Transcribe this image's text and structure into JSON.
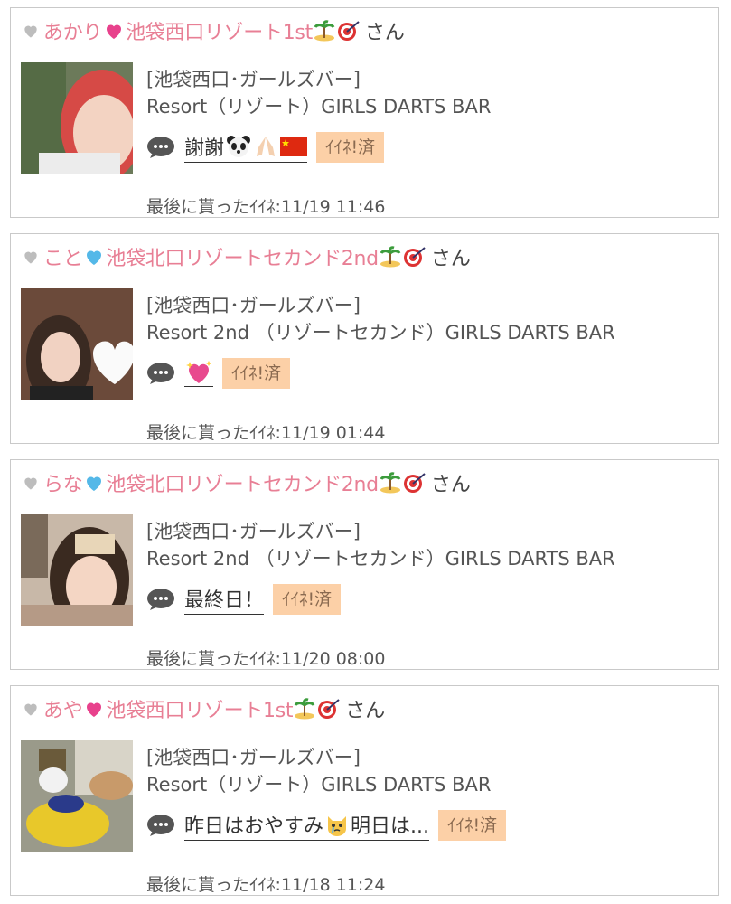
{
  "honorific": "さん",
  "badge_label": "ｲｲﾈ!済",
  "last_like_prefix": "最後に貰ったｲｲﾈ:",
  "colors": {
    "name": "#e87f95",
    "badge_bg": "#fcd0a7",
    "border": "#c9c9c9",
    "heart_gray": "#bdbdbd",
    "heart_pink": "#e8418c",
    "heart_blue": "#54b8e8"
  },
  "cards": [
    {
      "name_before": "あかり",
      "name_heart": "pink-heart-icon",
      "name_after": "池袋西口リゾート1st",
      "category": "[池袋西口･ガールズバー]",
      "shop": "Resort（リゾート）GIRLS DARTS BAR",
      "message": "謝謝",
      "message_icons": [
        "panda-icon",
        "folded-hands-icon",
        "china-flag-icon"
      ],
      "badge": "ｲｲﾈ!済",
      "last_like": "11/19 11:46"
    },
    {
      "name_before": "こと",
      "name_heart": "blue-heart-icon",
      "name_after": "池袋北口リゾートセカンド2nd",
      "category": "[池袋西口･ガールズバー]",
      "shop": "Resort 2nd （リゾートセカンド）GIRLS DARTS BAR",
      "message": "",
      "message_icons": [
        "sparkling-heart-icon"
      ],
      "badge": "ｲｲﾈ!済",
      "last_like": "11/19 01:44"
    },
    {
      "name_before": "らな",
      "name_heart": "blue-heart-icon",
      "name_after": "池袋北口リゾートセカンド2nd",
      "category": "[池袋西口･ガールズバー]",
      "shop": "Resort 2nd （リゾートセカンド）GIRLS DARTS BAR",
      "message": "最終日！",
      "message_icons": [],
      "badge": "ｲｲﾈ!済",
      "last_like": "11/20 08:00"
    },
    {
      "name_before": "あや",
      "name_heart": "pink-heart-icon",
      "name_after": "池袋西口リゾート1st",
      "category": "[池袋西口･ガールズバー]",
      "shop": "Resort（リゾート）GIRLS DARTS BAR",
      "message": "昨日はおやすみ",
      "message_icons": [
        "crying-cat-icon"
      ],
      "message_tail": "明日は...",
      "badge": "ｲｲﾈ!済",
      "last_like": "11/18 11:24"
    }
  ]
}
